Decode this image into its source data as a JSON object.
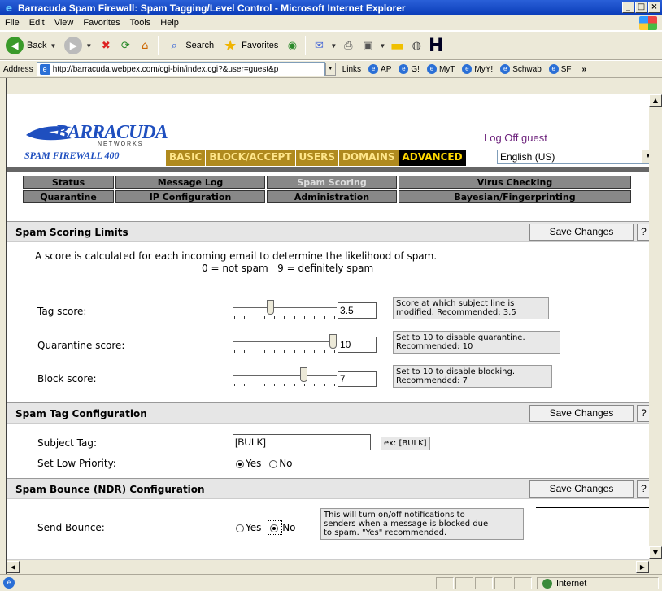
{
  "window": {
    "title": "Barracuda Spam Firewall: Spam Tagging/Level Control - Microsoft Internet Explorer",
    "min": "_",
    "max": "□",
    "close": "×"
  },
  "menu": [
    "File",
    "Edit",
    "View",
    "Favorites",
    "Tools",
    "Help"
  ],
  "toolbar": {
    "back": "Back",
    "search": "Search",
    "favorites": "Favorites"
  },
  "address": {
    "label": "Address",
    "url": "http://barracuda.webpex.com/cgi-bin/index.cgi?&user=guest&p"
  },
  "links": {
    "label": "Links",
    "items": [
      "AP",
      "G!",
      "MyT",
      "MyY!",
      "Schwab",
      "SF"
    ],
    "more": "»"
  },
  "header": {
    "brand": "BARRACUDA",
    "brand_sub": "NETWORKS",
    "product": "SPAM FIREWALL 400",
    "logoff": "Log Off guest",
    "nav": [
      "BASIC",
      "BLOCK/ACCEPT",
      "USERS",
      "DOMAINS",
      "ADVANCED"
    ],
    "active_nav": "ADVANCED",
    "language": "English (US)",
    "colors": {
      "nav_bg": "#b08a1e",
      "nav_text": "#ffe68a",
      "brand": "#1f4fbf",
      "logoff": "#6b1f7a"
    }
  },
  "subnav": {
    "row1": [
      "Status",
      "Message Log",
      "Spam Scoring",
      "Virus Checking"
    ],
    "row2": [
      "Quarantine",
      "IP Configuration",
      "Administration",
      "Bayesian/Fingerprinting"
    ],
    "active": "Spam Scoring"
  },
  "scoring": {
    "title": "Spam Scoring Limits",
    "save": "Save Changes",
    "help": "?",
    "desc1": "A score is calculated for each incoming email to determine the likelihood of spam.",
    "desc2": "0 = not spam   9 = definitely spam",
    "tag": {
      "label": "Tag score:",
      "value": "3.5",
      "level": 0.35,
      "hint1": "Score at which subject line is",
      "hint2": "modified. Recommended: 3.5"
    },
    "quarantine": {
      "label": "Quarantine score:",
      "value": "10",
      "level": 1.0,
      "hint1": "Set to 10 to disable quarantine.",
      "hint2": "Recommended: 10"
    },
    "block": {
      "label": "Block score:",
      "value": "7",
      "level": 0.7,
      "hint1": "Set to 10 to disable blocking.",
      "hint2": "Recommended: 7"
    }
  },
  "tagconfig": {
    "title": "Spam Tag Configuration",
    "save": "Save Changes",
    "help": "?",
    "subject_label": "Subject Tag:",
    "subject_value": "[BULK]",
    "subject_hint": "ex: [BULK]",
    "lowprio_label": "Set Low Priority:",
    "yes": "Yes",
    "no": "No",
    "lowprio_selected": "Yes"
  },
  "bounce": {
    "title": "Spam Bounce (NDR) Configuration",
    "save": "Save Changes",
    "help": "?",
    "label": "Send Bounce:",
    "yes": "Yes",
    "no": "No",
    "selected": "No",
    "hint1": "This will turn on/off notifications to",
    "hint2": "senders when a message is blocked due",
    "hint3": "to spam. \"Yes\" recommended."
  },
  "status": {
    "zone": "Internet"
  }
}
